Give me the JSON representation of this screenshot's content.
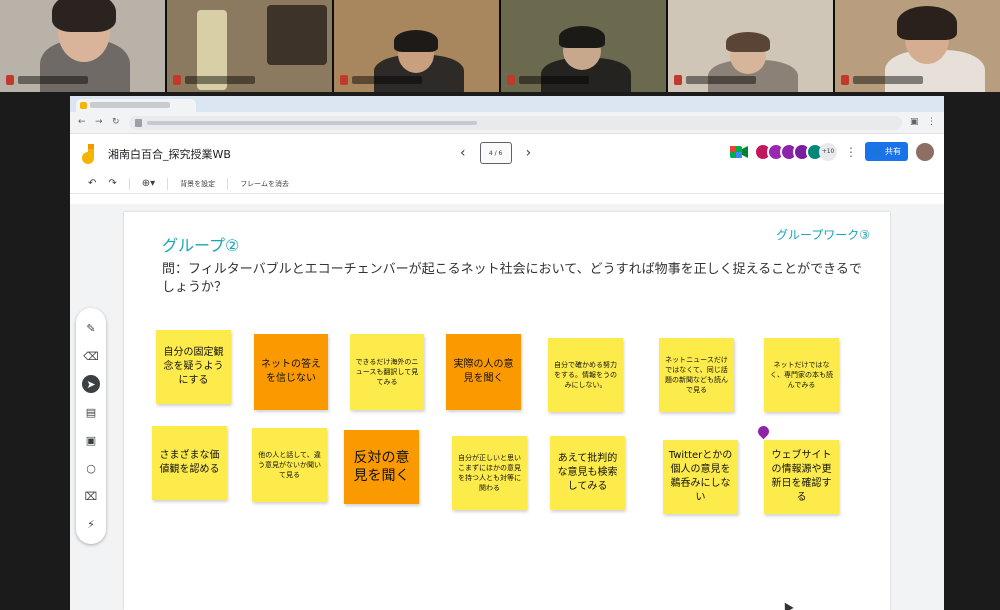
{
  "doc": {
    "title": "湘南白百合_探究授業WB"
  },
  "frame_nav": {
    "prev": "‹",
    "next": "›",
    "indicator": "4 / 6"
  },
  "collaborators": {
    "more": "+10",
    "colors": [
      "#c2185b",
      "#9c27b0",
      "#8e24aa",
      "#7b1fa2",
      "#00897b"
    ]
  },
  "share": {
    "label": "共有"
  },
  "toolbar": {
    "set_background": "背景を設定",
    "clear_frame": "フレームを消去"
  },
  "frame": {
    "group_title": "グループ②",
    "work_label": "グループワーク③",
    "question": "問：フィルターバブルとエコーチェンバーが起こるネット社会において、どうすれば物事を正しく捉えることができるでしょうか？"
  },
  "notes": [
    {
      "text": "自分の固定観念を疑うようにする",
      "color": "yellow"
    },
    {
      "text": "ネットの答えを信じない",
      "color": "orange"
    },
    {
      "text": "できるだけ海外のニュースも翻訳して見てみる",
      "color": "yellow"
    },
    {
      "text": "実際の人の意見を聞く",
      "color": "orange"
    },
    {
      "text": "自分で確かめる努力をする。情報をうのみにしない。",
      "color": "yellow"
    },
    {
      "text": "ネットニュースだけではなくて、同じ話題の新聞なども読んで見る",
      "color": "yellow"
    },
    {
      "text": "ネットだけではなく、専門家の本も読んでみる",
      "color": "yellow"
    },
    {
      "text": "さまざまな価値観を認める",
      "color": "yellow"
    },
    {
      "text": "他の人と話して、違う意見がないか聞いて見る",
      "color": "yellow"
    },
    {
      "text": "反対の意見を聞く",
      "color": "orange"
    },
    {
      "text": "自分が正しいと思いこまずにほかの意見を持つ人とも対等に関わる",
      "color": "yellow"
    },
    {
      "text": "あえて批判的な意見も検索してみる",
      "color": "yellow"
    },
    {
      "text": "Twitterとかの個人の意見を鵜呑みにしない",
      "color": "yellow"
    },
    {
      "text": "ウェブサイトの情報源や更新日を確認する",
      "color": "yellow"
    }
  ]
}
